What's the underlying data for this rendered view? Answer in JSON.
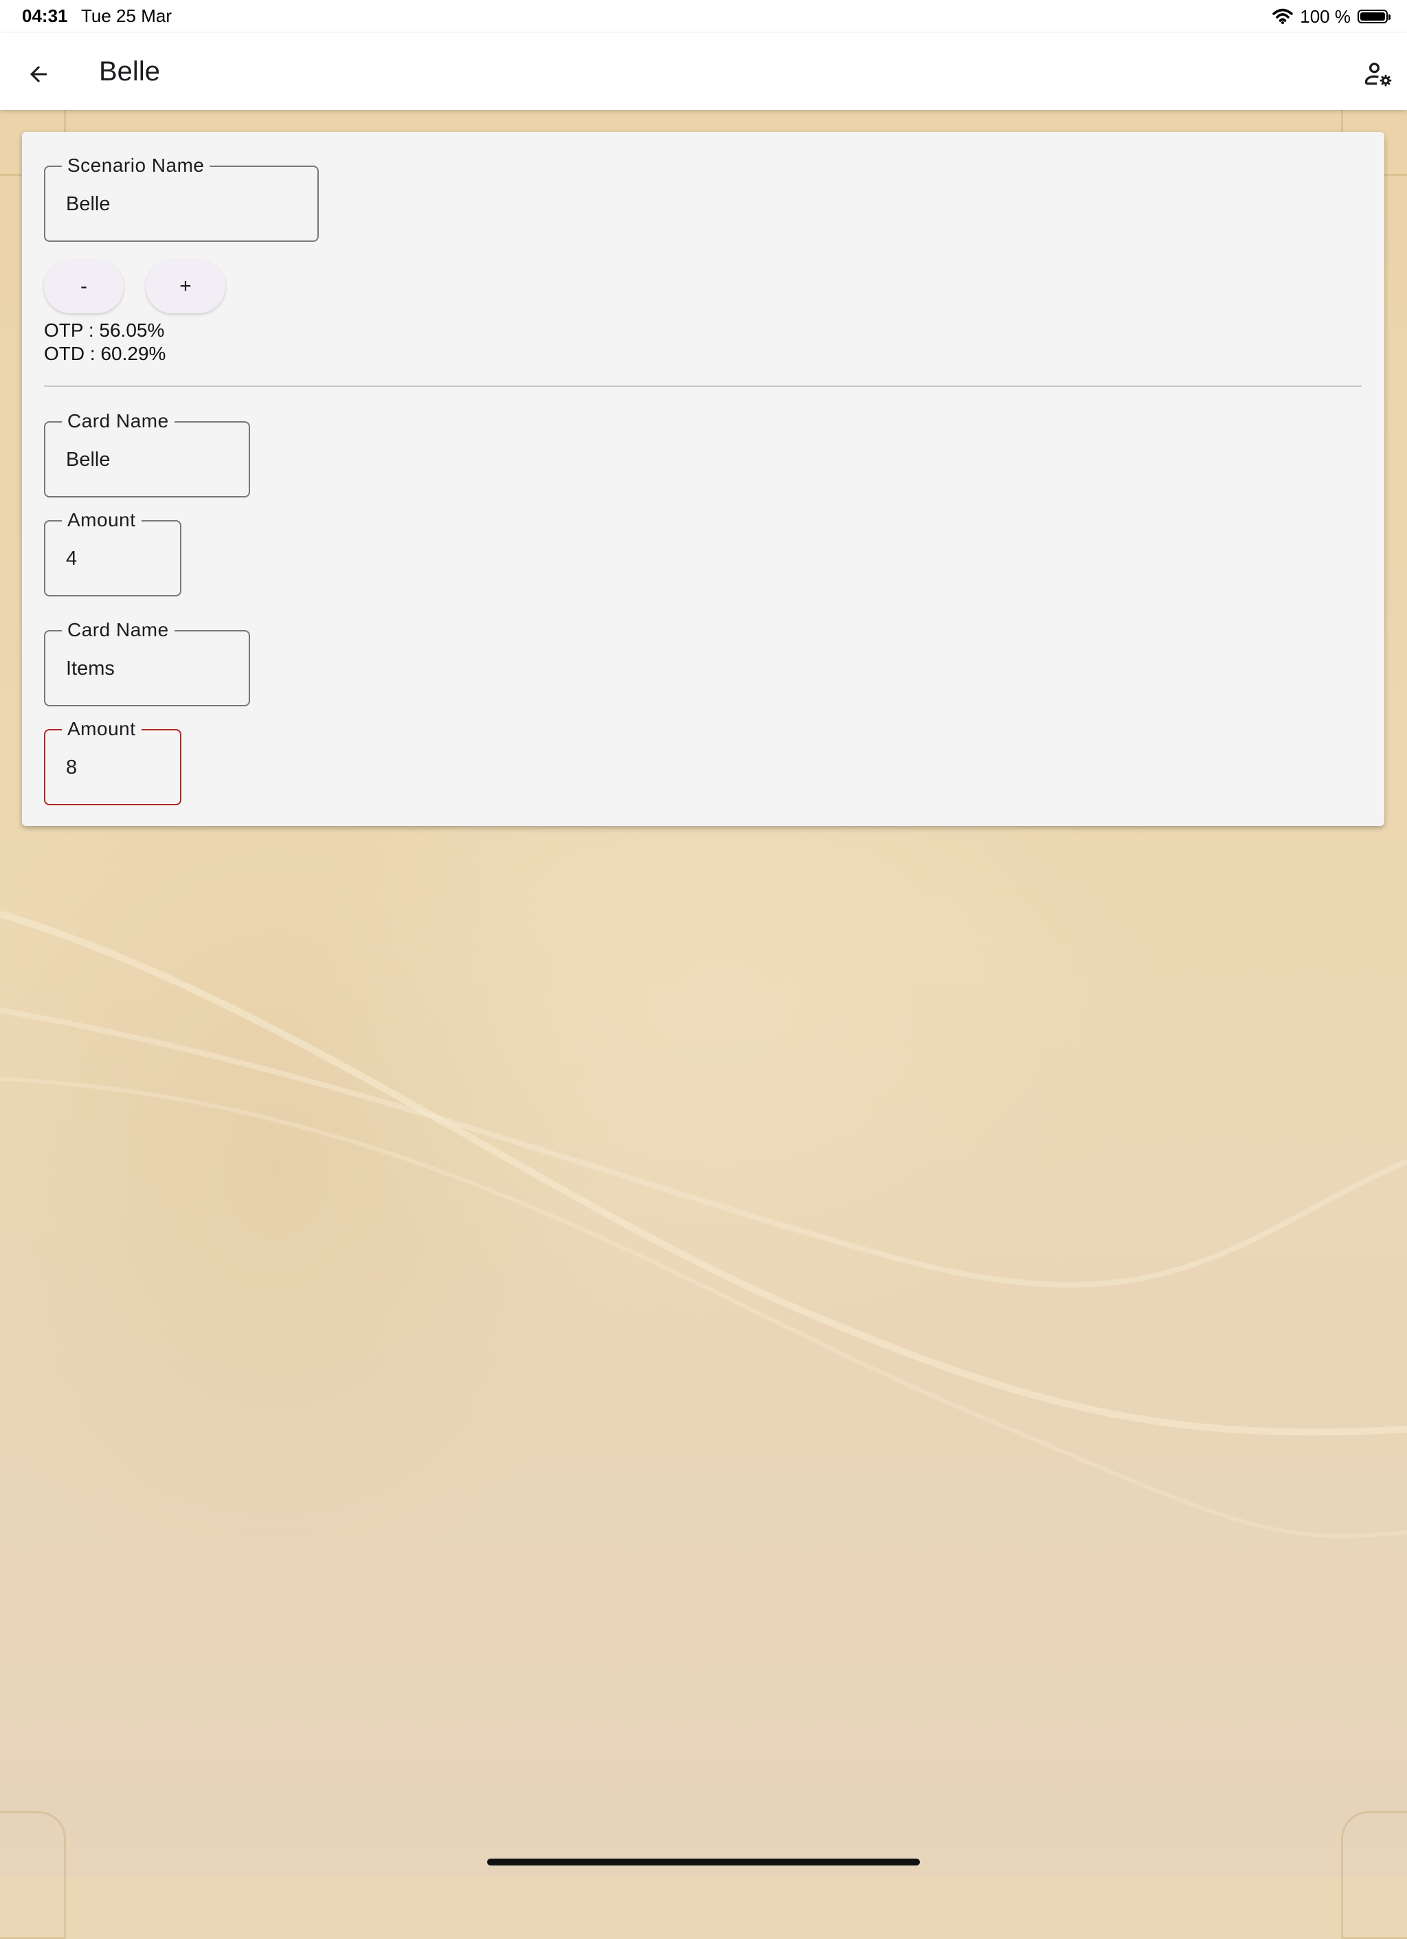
{
  "status_bar": {
    "time": "04:31",
    "date": "Tue 25 Mar",
    "battery": "100 %",
    "wifi_icon": "wifi-icon",
    "battery_icon": "battery-icon"
  },
  "app_bar": {
    "back_icon": "arrow-left-icon",
    "title": "Belle",
    "settings_icon": "person-gear-icon"
  },
  "scenario": {
    "label": "Scenario Name",
    "value": "Belle"
  },
  "buttons": {
    "minus": "-",
    "plus": "+"
  },
  "stats": {
    "otp": "OTP : 56.05%",
    "otd": "OTD : 60.29%"
  },
  "cards": [
    {
      "name_label": "Card Name",
      "name_value": "Belle",
      "amount_label": "Amount",
      "amount_value": "4",
      "amount_state": "normal"
    },
    {
      "name_label": "Card Name",
      "name_value": "Items",
      "amount_label": "Amount",
      "amount_value": "8",
      "amount_state": "error"
    }
  ],
  "colors": {
    "error_border": "#b3261e",
    "card_background": "#f4f4f4",
    "page_background": "#ead7b5"
  }
}
